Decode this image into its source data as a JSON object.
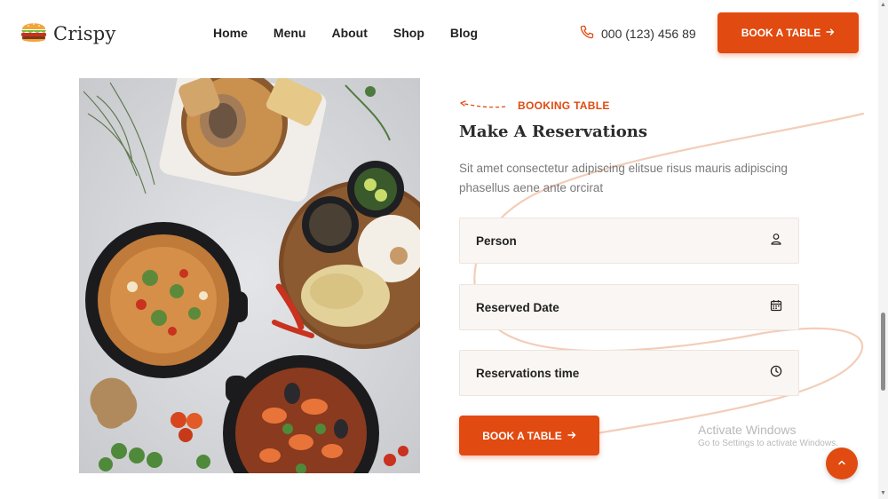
{
  "brand": {
    "name": "Crispy",
    "logo_icon": "burger-icon"
  },
  "nav": {
    "items": [
      {
        "label": "Home"
      },
      {
        "label": "Menu"
      },
      {
        "label": "About"
      },
      {
        "label": "Shop"
      },
      {
        "label": "Blog"
      }
    ]
  },
  "header": {
    "phone": "000 (123) 456 89",
    "phone_icon": "phone-icon",
    "book_button": "BOOK A TABLE",
    "book_button_icon": "arrow-right-icon"
  },
  "booking": {
    "eyebrow": "BOOKING TABLE",
    "title": "Make A Reservations",
    "description": "Sit amet consectetur adipiscing elitsue risus mauris adipiscing phasellus aene ante orcirat",
    "fields": [
      {
        "label": "Person",
        "icon": "user-icon"
      },
      {
        "label": "Reserved Date",
        "icon": "calendar-icon"
      },
      {
        "label": "Reservations time",
        "icon": "clock-icon"
      }
    ],
    "submit_label": "BOOK A TABLE"
  },
  "image": {
    "subject": "food-platter-image"
  },
  "watermark": {
    "title": "Activate Windows",
    "subtitle": "Go to Settings to activate Windows."
  },
  "colors": {
    "accent": "#e14a10",
    "field_bg": "#faf6f3",
    "swirl": "#f3cdb8"
  }
}
